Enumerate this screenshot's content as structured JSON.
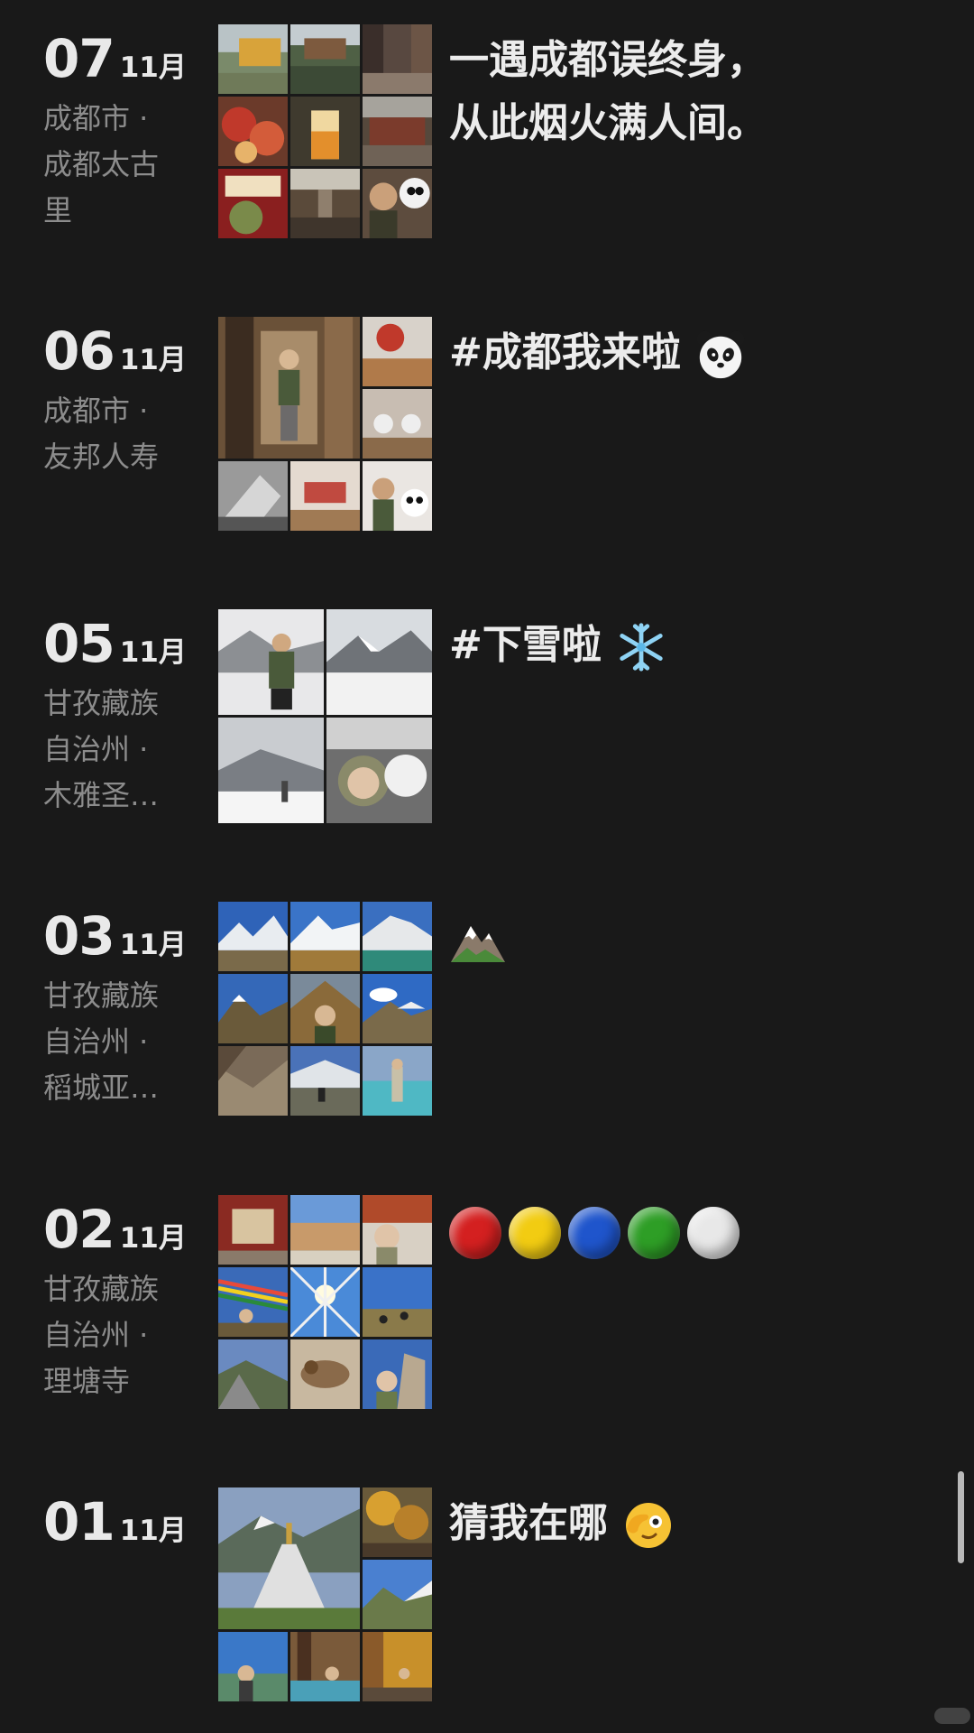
{
  "posts": [
    {
      "day": "07",
      "month": "11月",
      "location_lines": [
        "成都市 ·",
        "成都太古",
        "里"
      ],
      "caption_lines": [
        "一遇成都误终身，",
        "从此烟火满人间。"
      ],
      "photo_count": 9
    },
    {
      "day": "06",
      "month": "11月",
      "location_lines": [
        "成都市 ·",
        "友邦人寿"
      ],
      "caption_lines": [
        "#成都我来啦"
      ],
      "caption_emoji": "panda-face",
      "photo_count": 6
    },
    {
      "day": "05",
      "month": "11月",
      "location_lines": [
        "甘孜藏族",
        "自治州 ·",
        "木雅圣…"
      ],
      "caption_lines": [
        "#下雪啦"
      ],
      "caption_emoji": "snowflake",
      "photo_count": 4
    },
    {
      "day": "03",
      "month": "11月",
      "location_lines": [
        "甘孜藏族",
        "自治州 ·",
        "稻城亚…"
      ],
      "caption_lines": [],
      "caption_emoji": "snow-capped-mountain",
      "photo_count": 9
    },
    {
      "day": "02",
      "month": "11月",
      "location_lines": [
        "甘孜藏族",
        "自治州 ·",
        "理塘寺"
      ],
      "caption_lines": [],
      "caption_dots": [
        "#d42020",
        "#f2cc12",
        "#1f55cc",
        "#2e9e26",
        "#e8e8e8"
      ],
      "photo_count": 9
    },
    {
      "day": "01",
      "month": "11月",
      "location_lines": [],
      "caption_lines": [
        "猜我在哪"
      ],
      "caption_emoji": "face-with-hand-over-eye",
      "photo_count": 6
    }
  ],
  "colors": {
    "background": "#191919",
    "primary_text": "#e9e9e9",
    "secondary_text": "#8c8c8c"
  },
  "icons": [
    "panda-face-emoji",
    "snowflake-emoji",
    "mountain-emoji",
    "peeking-face-emoji"
  ]
}
